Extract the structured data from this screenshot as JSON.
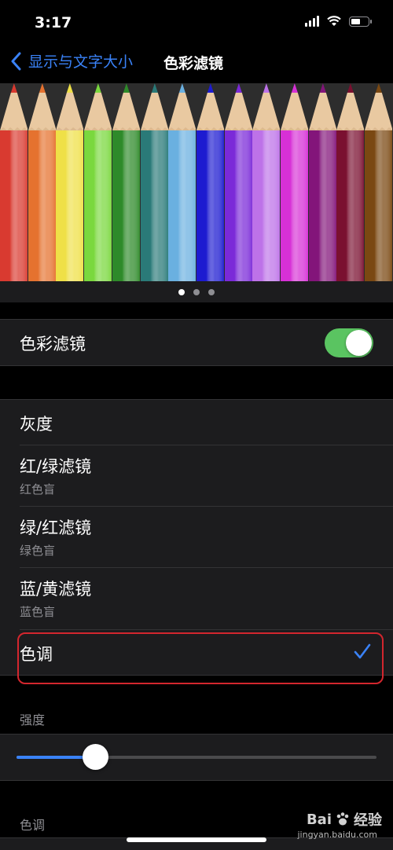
{
  "status_bar": {
    "time": "3:17"
  },
  "nav": {
    "back_label": "显示与文字大小",
    "title": "色彩滤镜"
  },
  "pencils": {
    "colors": [
      "#d93a30",
      "#e5722f",
      "#efe047",
      "#7ad83e",
      "#2e8a2a",
      "#2a7a78",
      "#6ab0e0",
      "#1d1bd0",
      "#7b2ad8",
      "#bd72e8",
      "#d730d6",
      "#83157a",
      "#7a1030",
      "#7a4812"
    ]
  },
  "pager": {
    "pages": 3,
    "active": 0
  },
  "color_filters": {
    "label": "色彩滤镜",
    "enabled": true
  },
  "filters": [
    {
      "label": "灰度",
      "sub": ""
    },
    {
      "label": "红/绿滤镜",
      "sub": "红色盲"
    },
    {
      "label": "绿/红滤镜",
      "sub": "绿色盲"
    },
    {
      "label": "蓝/黄滤镜",
      "sub": "蓝色盲"
    },
    {
      "label": "色调",
      "sub": "",
      "selected": true
    }
  ],
  "intensity": {
    "header": "强度",
    "value": 0.22
  },
  "hue": {
    "header": "色调"
  },
  "watermark": {
    "brand": "Bai",
    "brand2": "经验",
    "site": "jingyan.baidu.com"
  },
  "theme": {
    "accent": "#3a82f7",
    "toggle_on": "#5ac461",
    "highlight_box": "#d3262e"
  }
}
